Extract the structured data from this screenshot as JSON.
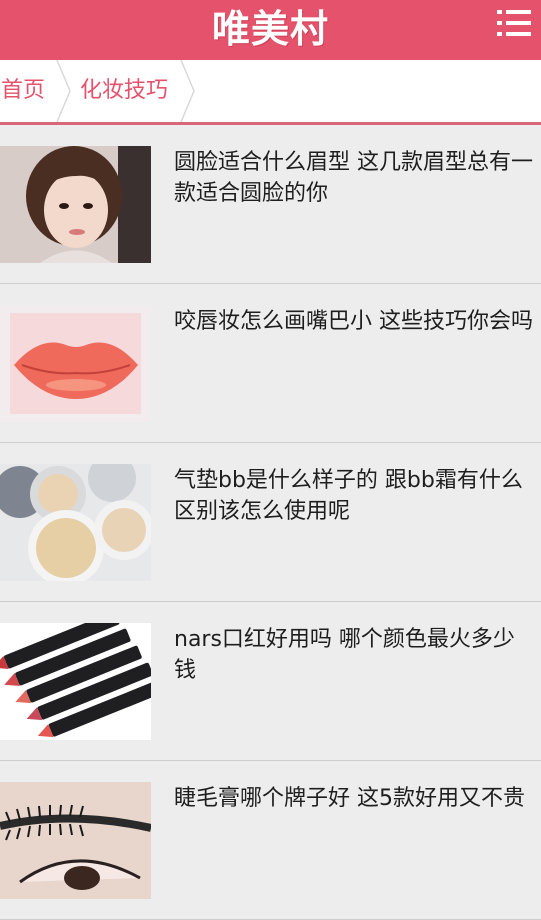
{
  "app": {
    "title": "唯美村"
  },
  "header": {
    "menu_icon": "hamburger-menu-icon"
  },
  "breadcrumb": {
    "items": [
      "首页",
      "化妆技巧"
    ]
  },
  "articles": [
    {
      "title": "圆脸适合什么眉型 这几款眉型总有一款适合圆脸的你",
      "thumb_icon": "portrait-photo"
    },
    {
      "title": "咬唇妆怎么画嘴巴小 这些技巧你会吗",
      "thumb_icon": "lips-photo"
    },
    {
      "title": "气垫bb是什么样子的 跟bb霜有什么区别该怎么使用呢",
      "thumb_icon": "cushion-compact-photo"
    },
    {
      "title": "nars口红好用吗 哪个颜色最火多少钱",
      "thumb_icon": "lipstick-pencils-photo"
    },
    {
      "title": "睫毛膏哪个牌子好 这5款好用又不贵",
      "thumb_icon": "mascara-photo"
    }
  ],
  "colors": {
    "brand": "#e4536b",
    "background": "#ededed",
    "text": "#1e1e1e"
  }
}
